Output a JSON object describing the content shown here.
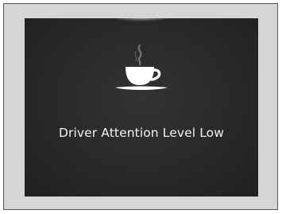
{
  "icons": {
    "alert_icon": "coffee-cup-icon"
  },
  "display": {
    "message": "Driver Attention Level Low"
  },
  "colors": {
    "background": "#2b2b2b",
    "frame": "#d5d5d5",
    "text": "#f2f2f2"
  }
}
